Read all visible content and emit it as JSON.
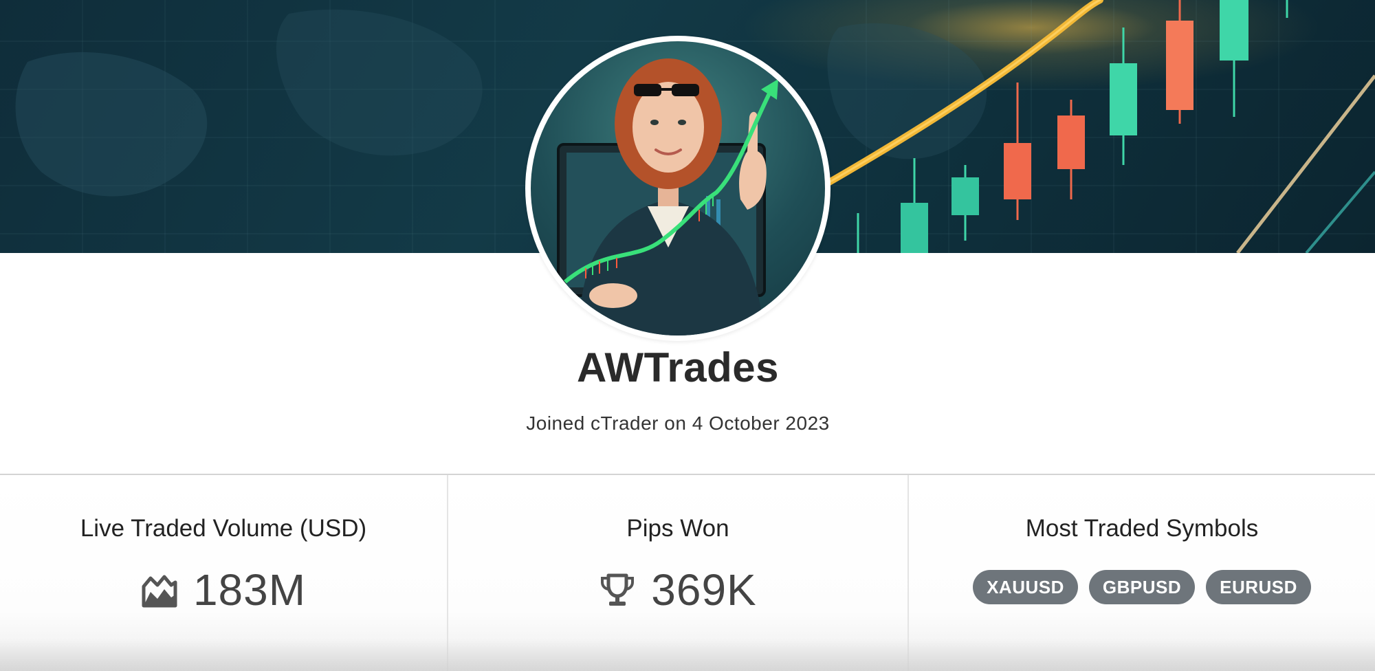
{
  "profile": {
    "username": "AWTrades",
    "joined": "Joined cTrader on 4 October 2023"
  },
  "stats": {
    "volume": {
      "title": "Live Traded Volume (USD)",
      "value": "183M",
      "icon": "volume-chart-icon"
    },
    "pips": {
      "title": "Pips Won",
      "value": "369K",
      "icon": "trophy-icon"
    },
    "symbols": {
      "title": "Most Traded Symbols",
      "items": [
        "XAUUSD",
        "GBPUSD",
        "EURUSD"
      ]
    }
  },
  "colors": {
    "banner_dark": "#0f2d3a",
    "candle_green": "#3fd6a8",
    "candle_red": "#f0694c",
    "chip_bg": "#6e757b",
    "divider": "#d4d4d4"
  }
}
